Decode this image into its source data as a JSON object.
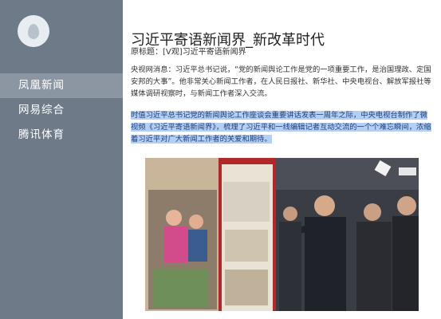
{
  "sidebar": {
    "logo_icon": "egg-icon",
    "items": [
      {
        "label": "凤凰新闻",
        "active": true
      },
      {
        "label": "网易综合",
        "active": false
      },
      {
        "label": "腾讯体育",
        "active": false
      }
    ]
  },
  "article": {
    "title": "习近平寄语新闻界_新改革时代",
    "original_title": "原标题：[V观]习近平寄语新闻界",
    "paragraph1": "央视网消息：习近平总书记说，“党的新闻舆论工作是党的一项重要工作，是治国理政、定国安邦的大事”。他非常关心新闻工作者，在人民日报社、新华社、中央电视台、解放军报社等媒体调研视察时，与新闻工作者深入交流。",
    "paragraph2_highlighted": "时值习近平总书记党的新闻舆论工作座谈会重要讲话发表一周年之际，中央电视台制作了微视频《习近平寄语新闻界》，梳理了习近平和一线编辑记者互动交流的一个个难忘瞬间，浓缩着习近平对广大新闻工作者的关爱和期待。",
    "photo_icon": "news-photo"
  },
  "colors": {
    "sidebar_bg": "#6f7a88",
    "sidebar_active": "#8c96a3",
    "highlight": "#b5cff3"
  }
}
